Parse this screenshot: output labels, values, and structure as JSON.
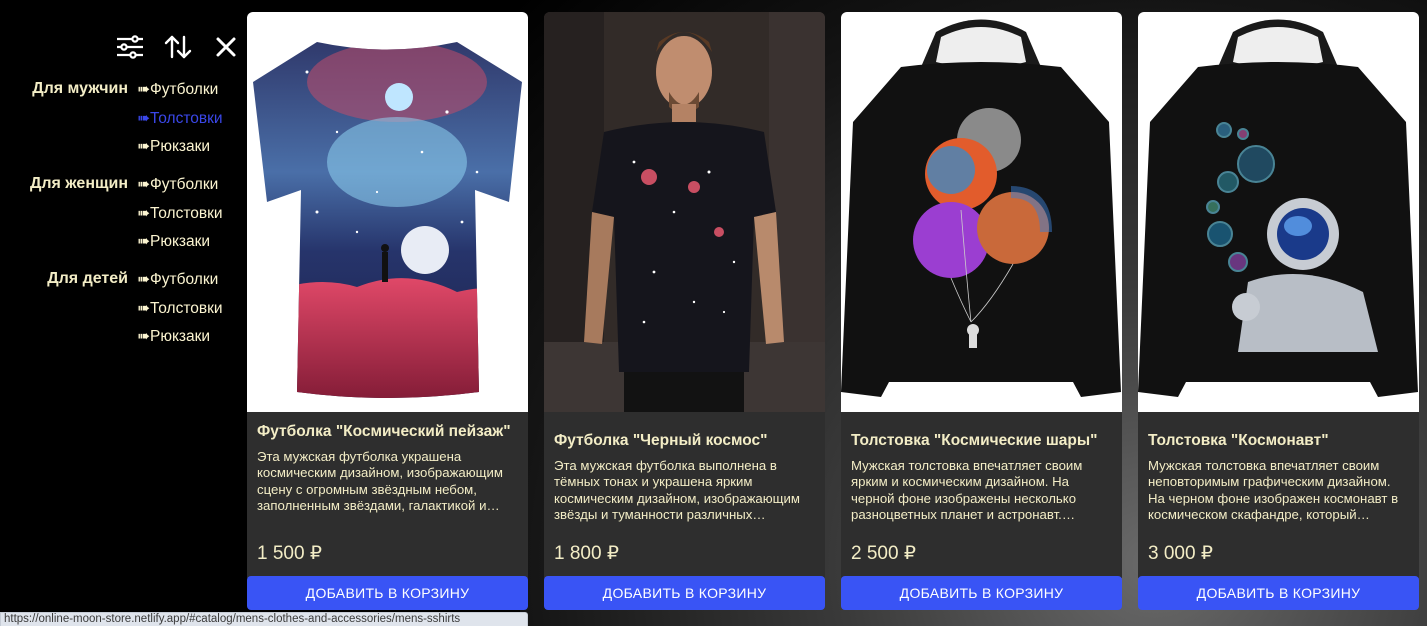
{
  "toolbar": {
    "filter_icon": "sliders-icon",
    "sort_icon": "sort-arrows-icon",
    "close_icon": "close-icon"
  },
  "menu": {
    "groups": [
      {
        "label": "Для мужчин",
        "items": [
          "➠Футболки",
          "➠Толстовки",
          "➠Рюкзаки"
        ],
        "active_index": 1
      },
      {
        "label": "Для женщин",
        "items": [
          "➠Футболки",
          "➠Толстовки",
          "➠Рюкзаки"
        ]
      },
      {
        "label": "Для детей",
        "items": [
          "➠Футболки",
          "➠Толстовки",
          "➠Рюкзаки"
        ]
      }
    ]
  },
  "products": [
    {
      "title": "Футболка \"Космический пейзаж\"",
      "description": "Эта мужская футболка украшена космическим дизайном, изображающим сцену с огромным звёздным небом, заполненным звёздами, галактикой и…",
      "price": "1 500 ₽",
      "button": "ДОБАВИТЬ В КОРЗИНУ"
    },
    {
      "title": "Футболка \"Черный космос\"",
      "description": "Эта мужская футболка выполнена в тёмных тонах и украшена ярким космическим дизайном, изображающим звёзды и туманности различных…",
      "price": "1 800 ₽",
      "button": "ДОБАВИТЬ В КОРЗИНУ"
    },
    {
      "title": "Толстовка \"Космические шары\"",
      "description": "Мужская толстовка впечатляет своим ярким и космическим дизайном. На черной фоне изображены несколько разноцветных планет и астронавт.…",
      "price": "2 500 ₽",
      "button": "ДОБАВИТЬ В КОРЗИНУ"
    },
    {
      "title": "Толстовка \"Космонавт\"",
      "description": "Мужская толстовка впечатляет своим неповторимым графическим дизайном. На черном фоне изображен космонавт в космическом скафандре, который…",
      "price": "3 000 ₽",
      "button": "ДОБАВИТЬ В КОРЗИНУ"
    }
  ],
  "status_bar": {
    "url": "https://online-moon-store.netlify.app/#catalog/mens-clothes-and-accessories/mens-sshirts"
  },
  "colors": {
    "accent_button": "#3954f5",
    "menu_text": "#fbf4d0",
    "menu_active": "#3a47e8",
    "card_body": "#2e2e2e"
  }
}
